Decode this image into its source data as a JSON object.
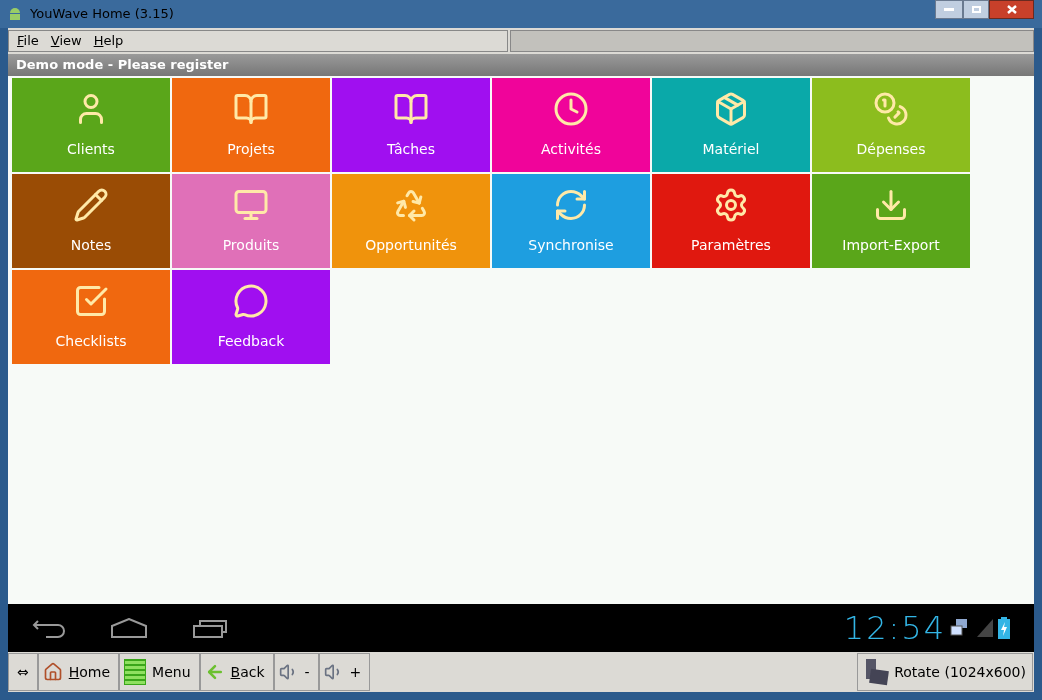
{
  "window": {
    "title": "YouWave Home (3.15)"
  },
  "menu": [
    {
      "label": "File"
    },
    {
      "label": "View"
    },
    {
      "label": "Help"
    }
  ],
  "banner": "Demo mode - Please register",
  "tiles": [
    {
      "label": "Clients",
      "color": "#5aa61a"
    },
    {
      "label": "Projets",
      "color": "#f0680f"
    },
    {
      "label": "Tâches",
      "color": "#a00ff0"
    },
    {
      "label": "Activités",
      "color": "#f0049a"
    },
    {
      "label": "Matériel",
      "color": "#0aa9a9"
    },
    {
      "label": "Dépenses",
      "color": "#8cbd1e"
    },
    {
      "label": "Notes",
      "color": "#9a4c05"
    },
    {
      "label": "Produits",
      "color": "#e070b8"
    },
    {
      "label": "Opportunités",
      "color": "#f0930c"
    },
    {
      "label": "Synchronise",
      "color": "#1e9ee0"
    },
    {
      "label": "Paramètres",
      "color": "#e0180f"
    },
    {
      "label": "Import-Export",
      "color": "#5aa61a"
    },
    {
      "label": "Checklists",
      "color": "#f0680f"
    },
    {
      "label": "Feedback",
      "color": "#a00ff0"
    }
  ],
  "status": {
    "time": "12:54"
  },
  "toolbar": [
    {
      "kind": "text",
      "label": "⇔",
      "underlined": false
    },
    {
      "kind": "home",
      "label": "Home",
      "underlined": true
    },
    {
      "kind": "menu",
      "label": "Menu",
      "underlined": false
    },
    {
      "kind": "back",
      "label": "Back",
      "underlined": true
    },
    {
      "kind": "volume",
      "label": "-",
      "underlined": false
    },
    {
      "kind": "volume",
      "label": "+",
      "underlined": false
    }
  ],
  "rotate": {
    "label": "Rotate (1024x600)"
  }
}
